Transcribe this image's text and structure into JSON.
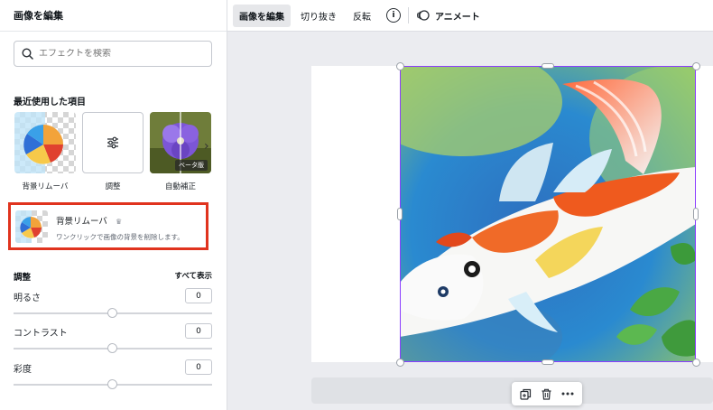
{
  "panel": {
    "title": "画像を編集",
    "search_placeholder": "エフェクトを検索",
    "recent_title": "最近使用した項目",
    "recent_items": [
      {
        "label": "背景リムーバ",
        "icon": "beach-ball"
      },
      {
        "label": "調整",
        "icon": "sliders-icon"
      },
      {
        "label": "自動補正",
        "icon": "flower",
        "badge": "ベータ版"
      }
    ],
    "feature": {
      "title": "背景リムーバ",
      "crown": "♛",
      "description": "ワンクリックで画像の背景を削除します。"
    },
    "adjust": {
      "title": "調整",
      "show_all": "すべて表示",
      "sliders": [
        {
          "label": "明るさ",
          "value": "0"
        },
        {
          "label": "コントラスト",
          "value": "0"
        },
        {
          "label": "彩度",
          "value": "0"
        }
      ]
    }
  },
  "toolbar": {
    "edit_image": "画像を編集",
    "crop": "切り抜き",
    "flip": "反転",
    "info": "i",
    "animate": "アニメート"
  },
  "colors": {
    "selection": "#8b3dff",
    "highlight_border": "#e0331e"
  }
}
